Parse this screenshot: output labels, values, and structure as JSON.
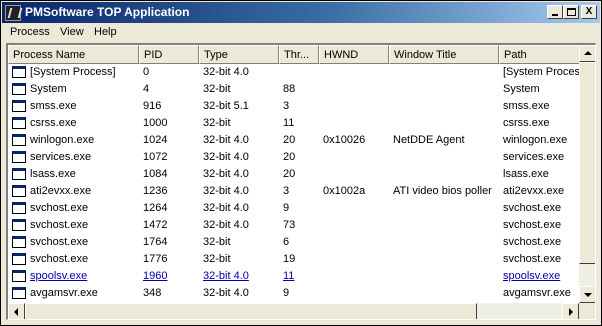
{
  "window": {
    "title": "PMSoftware TOP Application",
    "minimize_label": "_",
    "close_label": "X"
  },
  "menu": [
    "Process",
    "View",
    "Help"
  ],
  "columns": [
    "Process Name",
    "PID",
    "Type",
    "Thr...",
    "HWND",
    "Window Title",
    "Path"
  ],
  "rows": [
    {
      "name": "[System Process]",
      "pid": "0",
      "type": "32-bit 4.0",
      "threads": "",
      "hwnd": "",
      "title": "",
      "path": "[System Process",
      "link": false
    },
    {
      "name": "System",
      "pid": "4",
      "type": "32-bit",
      "threads": "88",
      "hwnd": "",
      "title": "",
      "path": "System",
      "link": false
    },
    {
      "name": "smss.exe",
      "pid": "916",
      "type": "32-bit 5.1",
      "threads": "3",
      "hwnd": "",
      "title": "",
      "path": "smss.exe",
      "link": false
    },
    {
      "name": "csrss.exe",
      "pid": "1000",
      "type": "32-bit",
      "threads": "11",
      "hwnd": "",
      "title": "",
      "path": "csrss.exe",
      "link": false
    },
    {
      "name": "winlogon.exe",
      "pid": "1024",
      "type": "32-bit 4.0",
      "threads": "20",
      "hwnd": "0x10026",
      "title": "NetDDE Agent",
      "path": "winlogon.exe",
      "link": false
    },
    {
      "name": "services.exe",
      "pid": "1072",
      "type": "32-bit 4.0",
      "threads": "20",
      "hwnd": "",
      "title": "",
      "path": "services.exe",
      "link": false
    },
    {
      "name": "lsass.exe",
      "pid": "1084",
      "type": "32-bit 4.0",
      "threads": "20",
      "hwnd": "",
      "title": "",
      "path": "lsass.exe",
      "link": false
    },
    {
      "name": "ati2evxx.exe",
      "pid": "1236",
      "type": "32-bit 4.0",
      "threads": "3",
      "hwnd": "0x1002a",
      "title": "ATI video bios poller",
      "path": "ati2evxx.exe",
      "link": false
    },
    {
      "name": "svchost.exe",
      "pid": "1264",
      "type": "32-bit 4.0",
      "threads": "9",
      "hwnd": "",
      "title": "",
      "path": "svchost.exe",
      "link": false
    },
    {
      "name": "svchost.exe",
      "pid": "1472",
      "type": "32-bit 4.0",
      "threads": "73",
      "hwnd": "",
      "title": "",
      "path": "svchost.exe",
      "link": false
    },
    {
      "name": "svchost.exe",
      "pid": "1764",
      "type": "32-bit",
      "threads": "6",
      "hwnd": "",
      "title": "",
      "path": "svchost.exe",
      "link": false
    },
    {
      "name": "svchost.exe",
      "pid": "1776",
      "type": "32-bit",
      "threads": "19",
      "hwnd": "",
      "title": "",
      "path": "svchost.exe",
      "link": false
    },
    {
      "name": "spoolsv.exe",
      "pid": "1960",
      "type": "32-bit 4.0",
      "threads": "11",
      "hwnd": "",
      "title": "",
      "path": "spoolsv.exe",
      "link": true
    },
    {
      "name": "avgamsvr.exe",
      "pid": "348",
      "type": "32-bit 4.0",
      "threads": "9",
      "hwnd": "",
      "title": "",
      "path": "avgamsvr.exe",
      "link": false
    }
  ]
}
